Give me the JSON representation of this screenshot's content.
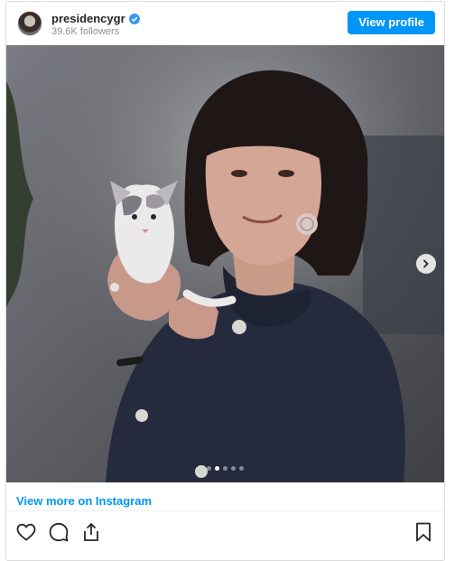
{
  "header": {
    "username": "presidencygr",
    "verified_icon": "verified-badge-icon",
    "followers": "39.6K followers",
    "view_profile_label": "View profile"
  },
  "photo": {
    "next_icon": "chevron-right-icon",
    "carousel_total": 5,
    "carousel_active_index": 1
  },
  "footer": {
    "view_more_label": "View more on Instagram",
    "actions": [
      "heart-icon",
      "comment-icon",
      "share-icon"
    ],
    "bookmark_icon": "bookmark-icon"
  },
  "colors": {
    "accent": "#0095f6",
    "text": "#262626",
    "muted": "#8e8e8e",
    "border": "#dbdbdb"
  }
}
